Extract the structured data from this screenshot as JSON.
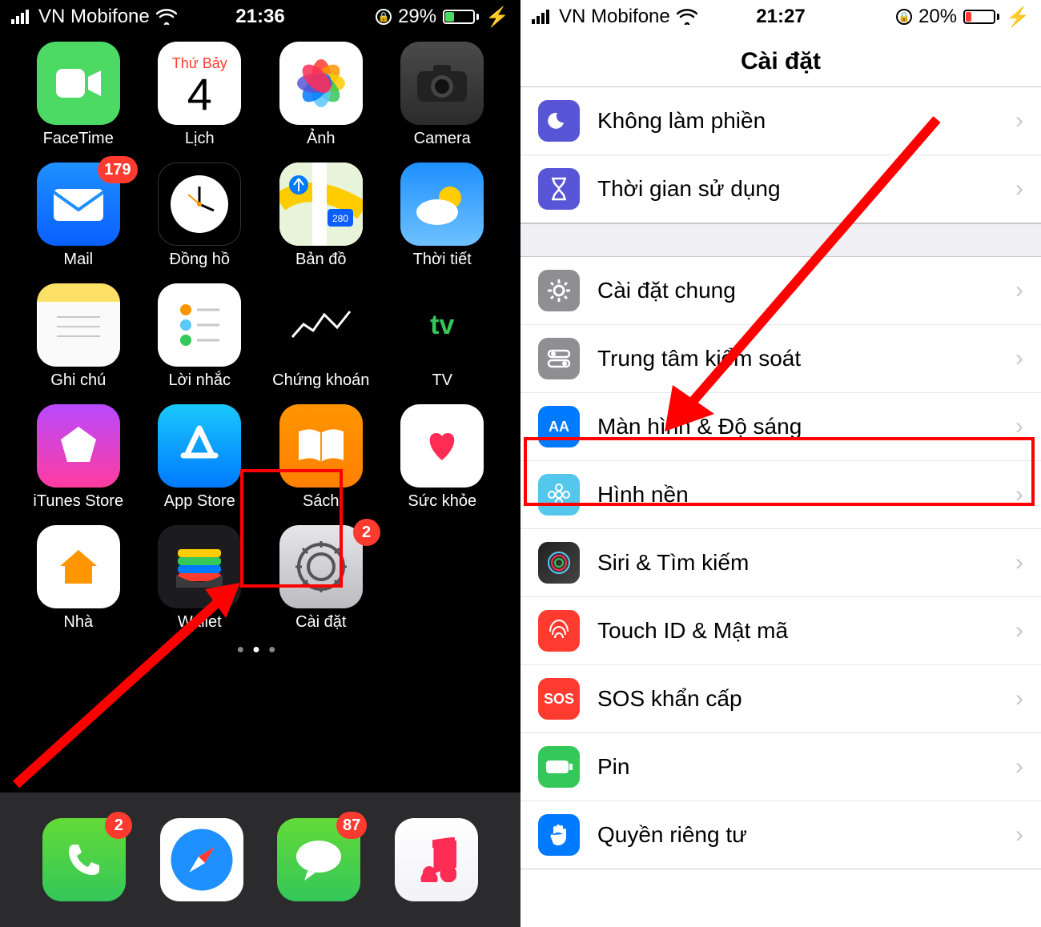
{
  "left": {
    "status": {
      "carrier": "VN Mobifone",
      "time": "21:36",
      "battery_pct": "29%"
    },
    "calendar": {
      "day_name": "Thứ Bảy",
      "day_num": "4"
    },
    "apps": [
      {
        "id": "facetime",
        "label": "FaceTime"
      },
      {
        "id": "calendar",
        "label": "Lịch"
      },
      {
        "id": "photos",
        "label": "Ảnh"
      },
      {
        "id": "camera",
        "label": "Camera"
      },
      {
        "id": "mail",
        "label": "Mail",
        "badge": "179"
      },
      {
        "id": "clock",
        "label": "Đồng hồ"
      },
      {
        "id": "maps",
        "label": "Bản đồ"
      },
      {
        "id": "weather",
        "label": "Thời tiết"
      },
      {
        "id": "notes",
        "label": "Ghi chú"
      },
      {
        "id": "reminders",
        "label": "Lời nhắc"
      },
      {
        "id": "stocks",
        "label": "Chứng khoán"
      },
      {
        "id": "tv",
        "label": "TV"
      },
      {
        "id": "itunes",
        "label": "iTunes Store"
      },
      {
        "id": "appstore",
        "label": "App Store"
      },
      {
        "id": "books",
        "label": "Sách"
      },
      {
        "id": "health",
        "label": "Sức khỏe"
      },
      {
        "id": "home",
        "label": "Nhà"
      },
      {
        "id": "wallet",
        "label": "Wallet"
      },
      {
        "id": "settings",
        "label": "Cài đặt",
        "badge": "2"
      }
    ],
    "dock": [
      {
        "id": "phone",
        "badge": "2"
      },
      {
        "id": "safari"
      },
      {
        "id": "messages",
        "badge": "87"
      },
      {
        "id": "music"
      }
    ]
  },
  "right": {
    "status": {
      "carrier": "VN Mobifone",
      "time": "21:27",
      "battery_pct": "20%"
    },
    "title": "Cài đặt",
    "rows": {
      "dnd": "Không làm phiền",
      "screentime": "Thời gian sử dụng",
      "general": "Cài đặt chung",
      "control": "Trung tâm kiểm soát",
      "display": "Màn hình & Độ sáng",
      "wallpaper": "Hình nền",
      "siri": "Siri & Tìm kiếm",
      "touchid": "Touch ID & Mật mã",
      "sos_label": "SOS khẩn cấp",
      "sos_icon": "SOS",
      "battery": "Pin",
      "privacy": "Quyền riêng tư"
    }
  }
}
